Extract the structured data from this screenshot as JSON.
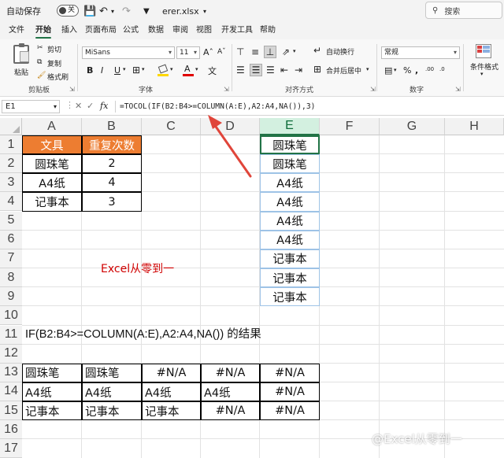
{
  "titlebar": {
    "autosave_label": "自动保存",
    "autosave_state": "关",
    "filename": "erer.xlsx",
    "search_placeholder": "搜索"
  },
  "menu_tabs": [
    "文件",
    "开始",
    "插入",
    "页面布局",
    "公式",
    "数据",
    "审阅",
    "视图",
    "开发工具",
    "帮助"
  ],
  "active_tab": "开始",
  "ribbon": {
    "clipboard": {
      "paste": "粘贴",
      "cut": "剪切",
      "copy": "复制",
      "format_painter": "格式刷",
      "group": "剪贴板"
    },
    "font": {
      "name": "MiSans",
      "size": "11",
      "bold": "B",
      "italic": "I",
      "underline": "U",
      "group": "字体"
    },
    "alignment": {
      "wrap": "自动换行",
      "merge": "合并后居中",
      "group": "对齐方式"
    },
    "number": {
      "format": "常规",
      "group": "数字"
    },
    "styles": {
      "conditional": "条件格式"
    }
  },
  "formula_bar": {
    "name_box": "E1",
    "fx": "fx",
    "formula": "=TOCOL(IF(B2:B4>=COLUMN(A:E),A2:A4,NA()),3)"
  },
  "columns": [
    "A",
    "B",
    "C",
    "D",
    "E",
    "F",
    "G",
    "H"
  ],
  "rows": [
    "1",
    "2",
    "3",
    "4",
    "5",
    "6",
    "7",
    "8",
    "9",
    "10",
    "11",
    "12",
    "13",
    "14",
    "15",
    "16",
    "17"
  ],
  "source_table": {
    "headers": [
      "文具",
      "重复次数"
    ],
    "rows": [
      [
        "圆珠笔",
        "2"
      ],
      [
        "A4纸",
        "4"
      ],
      [
        "记事本",
        "3"
      ]
    ]
  },
  "result_column": [
    "圆珠笔",
    "圆珠笔",
    "A4纸",
    "A4纸",
    "A4纸",
    "A4纸",
    "记事本",
    "记事本",
    "记事本"
  ],
  "annotation": "Excel从零到一",
  "description": "IF(B2:B4>=COLUMN(A:E),A2:A4,NA())   的结果",
  "if_result": [
    [
      "圆珠笔",
      "圆珠笔",
      "#N/A",
      "#N/A",
      "#N/A"
    ],
    [
      "A4纸",
      "A4纸",
      "A4纸",
      "A4纸",
      "#N/A"
    ],
    [
      "记事本",
      "记事本",
      "记事本",
      "#N/A",
      "#N/A"
    ]
  ],
  "watermark": "@Excel从零到一",
  "colors": {
    "accent": "#217346",
    "orange": "#ed7d31",
    "annotation": "#d00000",
    "arrow": "#e0453a"
  }
}
